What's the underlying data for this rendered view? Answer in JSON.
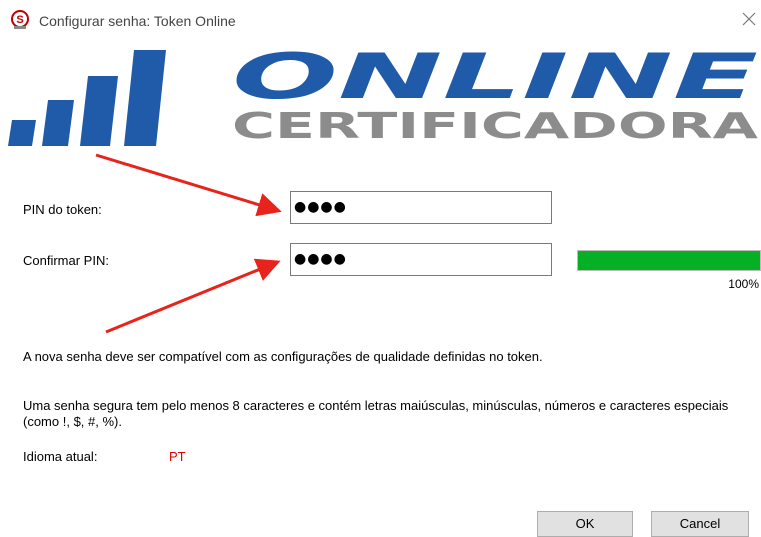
{
  "window": {
    "title": "Configurar senha: Token Online",
    "close_glyph": "✕",
    "app_icon": "red-s-icon"
  },
  "logo": {
    "brand_top": "ONLINE",
    "brand_bottom": "CERTIFICADORA",
    "colors": {
      "primary": "#1f5ba8",
      "secondary": "#8c8c8c"
    }
  },
  "form": {
    "pin_label": "PIN do token:",
    "pin_value": "●●●●",
    "confirm_label": "Confirmar PIN:",
    "confirm_value": "●●●●"
  },
  "strength": {
    "percent_value": 100,
    "percent_label": "100%",
    "color": "#06b025"
  },
  "info": {
    "line1": "A nova senha deve ser compatível com as configurações de qualidade definidas no token.",
    "line2": "Uma senha segura tem pelo menos 8 caracteres e contém letras maiúsculas, minúsculas, números e caracteres especiais (como !, $, #, %)."
  },
  "language": {
    "label": "Idioma atual:",
    "value": "PT"
  },
  "buttons": {
    "ok": "OK",
    "cancel": "Cancel"
  },
  "annotation_color": "#e8231b"
}
